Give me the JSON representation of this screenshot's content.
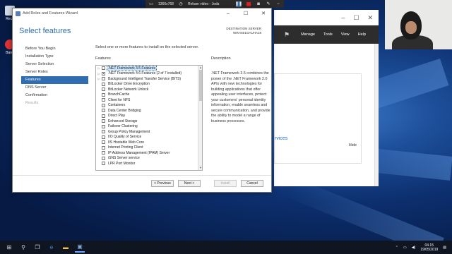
{
  "recorder": {
    "resolution": "1366x768",
    "status": "Rekam video - Jeda"
  },
  "desktop_icons": [
    {
      "label": "Recy"
    },
    {
      "label": "Band"
    }
  ],
  "server_manager": {
    "menu": [
      "Manage",
      "Tools",
      "View",
      "Help"
    ],
    "services_link": "rvices",
    "hide_label": "Hide"
  },
  "wizard": {
    "window_title": "Add Roles and Features Wizard",
    "heading": "Select features",
    "destination_label": "DESTINATION SERVER",
    "destination_server": "WIN-84I1GAUHA18",
    "nav": [
      {
        "label": "Before You Begin",
        "state": "normal"
      },
      {
        "label": "Installation Type",
        "state": "normal"
      },
      {
        "label": "Server Selection",
        "state": "normal"
      },
      {
        "label": "Server Roles",
        "state": "normal"
      },
      {
        "label": "Features",
        "state": "active"
      },
      {
        "label": "DNS Server",
        "state": "normal"
      },
      {
        "label": "Confirmation",
        "state": "normal"
      },
      {
        "label": "Results",
        "state": "disabled"
      }
    ],
    "instruction": "Select one or more features to install on the selected server.",
    "features_label": "Features",
    "description_label": "Description",
    "features": [
      {
        "label": ".NET Framework 3.5 Features",
        "expand": "▷",
        "state": "empty",
        "selected": true
      },
      {
        "label": ".NET Framework 4.6 Features (2 of 7 installed)",
        "expand": "▷",
        "state": "partial",
        "selected": false
      },
      {
        "label": "Background Intelligent Transfer Service (BITS)",
        "expand": "▷",
        "state": "empty",
        "selected": false
      },
      {
        "label": "BitLocker Drive Encryption",
        "expand": "",
        "state": "empty",
        "selected": false
      },
      {
        "label": "BitLocker Network Unlock",
        "expand": "",
        "state": "empty",
        "selected": false
      },
      {
        "label": "BranchCache",
        "expand": "",
        "state": "empty",
        "selected": false
      },
      {
        "label": "Client for NFS",
        "expand": "",
        "state": "empty",
        "selected": false
      },
      {
        "label": "Containers",
        "expand": "",
        "state": "empty",
        "selected": false
      },
      {
        "label": "Data Center Bridging",
        "expand": "",
        "state": "empty",
        "selected": false
      },
      {
        "label": "Direct Play",
        "expand": "",
        "state": "empty",
        "selected": false
      },
      {
        "label": "Enhanced Storage",
        "expand": "",
        "state": "empty",
        "selected": false
      },
      {
        "label": "Failover Clustering",
        "expand": "",
        "state": "empty",
        "selected": false
      },
      {
        "label": "Group Policy Management",
        "expand": "",
        "state": "empty",
        "selected": false
      },
      {
        "label": "I/O Quality of Service",
        "expand": "",
        "state": "empty",
        "selected": false
      },
      {
        "label": "IIS Hostable Web Core",
        "expand": "",
        "state": "empty",
        "selected": false
      },
      {
        "label": "Internet Printing Client",
        "expand": "",
        "state": "empty",
        "selected": false
      },
      {
        "label": "IP Address Management (IPAM) Server",
        "expand": "",
        "state": "empty",
        "selected": false
      },
      {
        "label": "iSNS Server service",
        "expand": "",
        "state": "empty",
        "selected": false
      },
      {
        "label": "LPR Port Monitor",
        "expand": "",
        "state": "empty",
        "selected": false
      }
    ],
    "description": ".NET Framework 3.5 combines the power of the .NET Framework 2.0 APIs with new technologies for building applications that offer appealing user interfaces, protect your customers' personal identity information, enable seamless and secure communication, and provide the ability to model a range of business processes.",
    "buttons": {
      "previous": "< Previous",
      "next": "Next >",
      "install": "Install",
      "cancel": "Cancel"
    }
  },
  "taskbar": {
    "time": "04.15",
    "date": "19/05/2019"
  }
}
